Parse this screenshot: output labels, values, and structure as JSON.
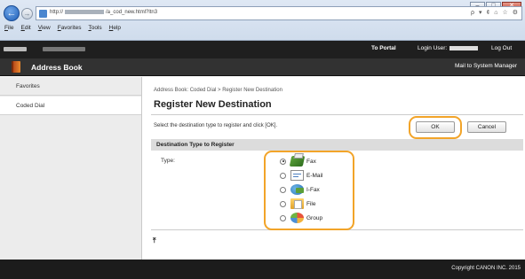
{
  "browser": {
    "url_prefix": "http://",
    "url_suffix": "/a_cod_new.html?ltn3",
    "addr_tools": [
      "ρ",
      "▾",
      "¢",
      "⌂",
      "☆",
      "⚙"
    ],
    "menu": [
      "File",
      "Edit",
      "View",
      "Favorites",
      "Tools",
      "Help"
    ],
    "window_buttons": [
      "–",
      "□",
      "✕"
    ]
  },
  "portal": {
    "to_portal": "To Portal",
    "login_user_label": "Login User:",
    "log_out": "Log Out"
  },
  "header": {
    "title": "Address Book",
    "mail_link": "Mail to System Manager"
  },
  "sidebar": {
    "items": [
      {
        "label": "Favorites"
      },
      {
        "label": "Coded Dial"
      }
    ]
  },
  "main": {
    "breadcrumb": "Address Book: Coded Dial > Register New Destination",
    "title": "Register New Destination",
    "instruction": "Select the destination type to register and click [OK].",
    "ok_label": "OK",
    "cancel_label": "Cancel",
    "section_title": "Destination Type to Register",
    "type_label": "Type:",
    "options": [
      {
        "label": "Fax",
        "icon": "fax-icon",
        "checked": true
      },
      {
        "label": "E-Mail",
        "icon": "email-icon",
        "checked": false
      },
      {
        "label": "I-Fax",
        "icon": "ifax-icon",
        "checked": false
      },
      {
        "label": "File",
        "icon": "file-icon",
        "checked": false
      },
      {
        "label": "Group",
        "icon": "group-icon",
        "checked": false
      }
    ],
    "collapse_glyph": "⤒"
  },
  "footer": {
    "copyright": "Copyright CANON INC. 2015"
  },
  "colors": {
    "highlight": "#f2a429",
    "header_bg": "#323232",
    "portal_bg": "#1f1f1f"
  }
}
